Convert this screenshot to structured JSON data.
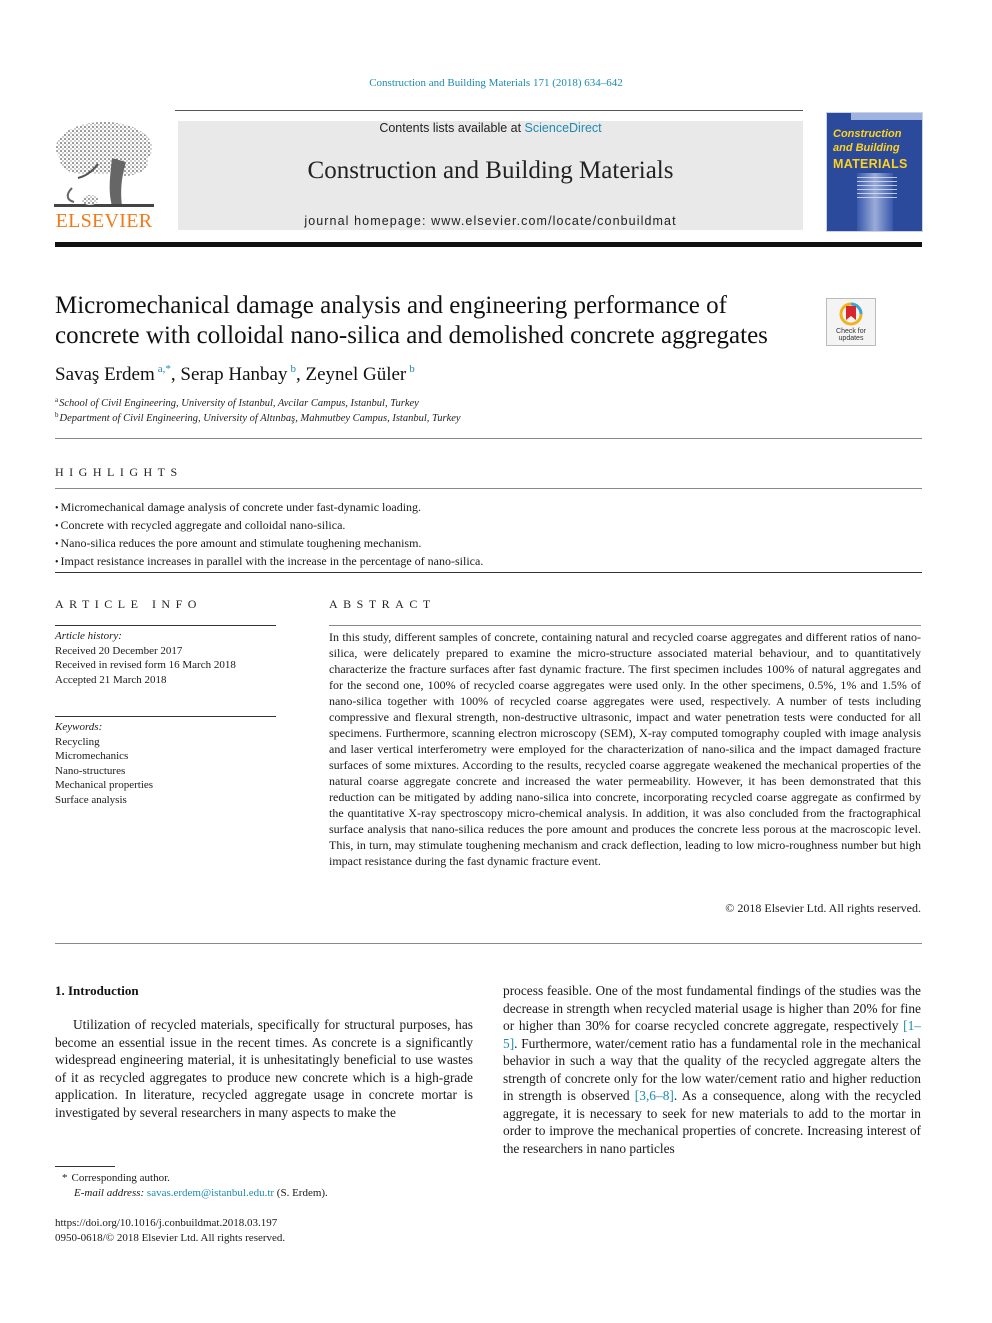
{
  "running_head": "Construction and Building Materials 171 (2018) 634–642",
  "publisher": {
    "logo_icon": "elsevier-tree-icon",
    "name": "ELSEVIER"
  },
  "banner": {
    "contents_prefix": "Contents lists available at ",
    "contents_link": "ScienceDirect",
    "journal_title": "Construction and Building Materials",
    "homepage": "journal homepage: www.elsevier.com/locate/conbuildmat"
  },
  "cover": {
    "line1": "Construction",
    "line2": "and Building",
    "line3": "MATERIALS"
  },
  "crossmark": {
    "icon": "crossmark-icon",
    "line1": "Check for",
    "line2": "updates"
  },
  "article": {
    "title_line1": "Micromechanical damage analysis and engineering performance of",
    "title_line2": "concrete with colloidal nano-silica and demolished concrete aggregates",
    "authors": [
      {
        "name": "Savaş Erdem",
        "sup": "a,*",
        "sep": ", "
      },
      {
        "name": "Serap Hanbay",
        "sup": "b",
        "sep": ", "
      },
      {
        "name": "Zeynel Güler",
        "sup": "b",
        "sep": ""
      }
    ],
    "affiliations": [
      {
        "key": "a",
        "text": "School of Civil Engineering, University of Istanbul, Avcilar Campus, Istanbul, Turkey"
      },
      {
        "key": "b",
        "text": "Department of Civil Engineering, University of Altınbaş, Mahmutbey Campus, Istanbul, Turkey"
      }
    ]
  },
  "highlights": {
    "heading": "HIGHLIGHTS",
    "items": [
      "Micromechanical damage analysis of concrete under fast-dynamic loading.",
      "Concrete with recycled aggregate and colloidal nano-silica.",
      "Nano-silica reduces the pore amount and stimulate toughening mechanism.",
      "Impact resistance increases in parallel with the increase in the percentage of nano-silica."
    ]
  },
  "article_info": {
    "heading": "ARTICLE INFO",
    "history_label": "Article history:",
    "history": [
      "Received 20 December 2017",
      "Received in revised form 16 March 2018",
      "Accepted 21 March 2018"
    ],
    "keywords_label": "Keywords:",
    "keywords": [
      "Recycling",
      "Micromechanics",
      "Nano-structures",
      "Mechanical properties",
      "Surface analysis"
    ]
  },
  "abstract": {
    "heading": "ABSTRACT",
    "text": "In this study, different samples of concrete, containing natural and recycled coarse aggregates and different ratios of nano-silica, were delicately prepared to examine the micro-structure associated material behaviour, and to quantitatively characterize the fracture surfaces after fast dynamic fracture. The first specimen includes 100% of natural aggregates and for the second one, 100% of recycled coarse aggregates were used only. In the other specimens, 0.5%, 1% and 1.5% of nano-silica together with 100% of recycled coarse aggregates were used, respectively. A number of tests including compressive and flexural strength, non-destructive ultrasonic, impact and water penetration tests were conducted for all specimens. Furthermore, scanning electron microscopy (SEM), X-ray computed tomography coupled with image analysis and laser vertical interferometry were employed for the characterization of nano-silica and the impact damaged fracture surfaces of some mixtures. According to the results, recycled coarse aggregate weakened the mechanical properties of the natural coarse aggregate concrete and increased the water permeability. However, it has been demonstrated that this reduction can be mitigated by adding nano-silica into concrete, incorporating recycled coarse aggregate as confirmed by the quantitative X-ray spectroscopy micro-chemical analysis. In addition, it was also concluded from the fractographical surface analysis that nano-silica reduces the pore amount and produces the concrete less porous at the macroscopic level. This, in turn, may stimulate toughening mechanism and crack deflection, leading to low micro-roughness number but high impact resistance during the fast dynamic fracture event.",
    "copyright": "© 2018 Elsevier Ltd. All rights reserved."
  },
  "introduction": {
    "heading": "1. Introduction",
    "left_text": "Utilization of recycled materials, specifically for structural purposes, has become an essential issue in the recent times. As concrete is a significantly widespread engineering material, it is unhesitatingly beneficial to use wastes of it as recycled aggregates to produce new concrete which is a high-grade application. In literature, recycled aggregate usage in concrete mortar is investigated by several researchers in many aspects to make the",
    "right_part1": "process feasible. One of the most fundamental findings of the studies was the decrease in strength when recycled material usage is higher than 20% for fine or higher than 30% for coarse recycled concrete aggregate, respectively ",
    "ref1": "[1–5]",
    "right_part2": ". Furthermore, water/cement ratio has a fundamental role in the mechanical behavior in such a way that the quality of the recycled aggregate alters the strength of concrete only for the low water/cement ratio and higher reduction in strength is observed ",
    "ref2": "[3,6–8]",
    "right_part3": ". As a consequence, along with the recycled aggregate, it is necessary to seek for new materials to add to the mortar in order to improve the mechanical properties of concrete. Increasing interest of the researchers in nano particles"
  },
  "footnotes": {
    "corresponding_marker": "*",
    "corresponding": "Corresponding author.",
    "email_label": "E-mail address:",
    "email": "savas.erdem@istanbul.edu.tr",
    "email_suffix": " (S. Erdem).",
    "doi": "https://doi.org/10.1016/j.conbuildmat.2018.03.197",
    "issn_line": "0950-0618/© 2018 Elsevier Ltd. All rights reserved."
  }
}
